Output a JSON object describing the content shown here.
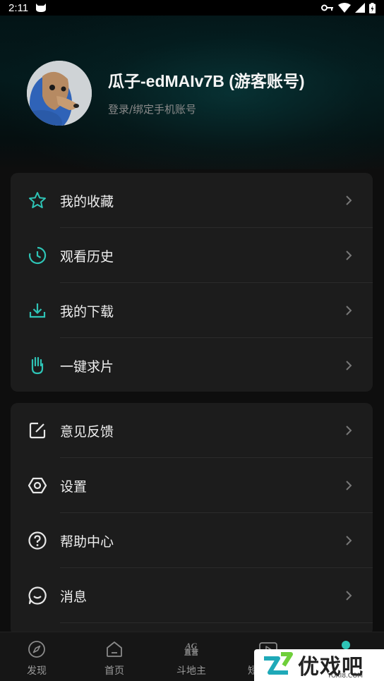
{
  "status_bar": {
    "time": "2:11"
  },
  "profile": {
    "username": "瓜子-edMAIv7B (游客账号)",
    "login_hint": "登录/绑定手机账号"
  },
  "menu_group_1": [
    {
      "label": "我的收藏",
      "icon": "star-icon"
    },
    {
      "label": "观看历史",
      "icon": "history-clock-icon"
    },
    {
      "label": "我的下载",
      "icon": "download-icon"
    },
    {
      "label": "一键求片",
      "icon": "hand-icon"
    }
  ],
  "menu_group_2": [
    {
      "label": "意见反馈",
      "icon": "edit-square-icon"
    },
    {
      "label": "设置",
      "icon": "hexagon-settings-icon"
    },
    {
      "label": "帮助中心",
      "icon": "help-circle-icon"
    },
    {
      "label": "消息",
      "icon": "chat-bubble-icon"
    }
  ],
  "bottom_nav": [
    {
      "label": "发现",
      "icon": "compass-icon"
    },
    {
      "label": "首页",
      "icon": "home-icon"
    },
    {
      "label": "斗地主",
      "icon": "ag-logo-icon",
      "icon_text": "AG",
      "icon_subtext": "直营"
    },
    {
      "label": "短",
      "icon": "video-play-icon"
    }
  ],
  "watermark": {
    "brand": "优戏吧",
    "url": "YOXI8.COM"
  },
  "colors": {
    "accent": "#2ec4b6",
    "card": "#1c1c1c",
    "background": "#0e0e0e"
  }
}
